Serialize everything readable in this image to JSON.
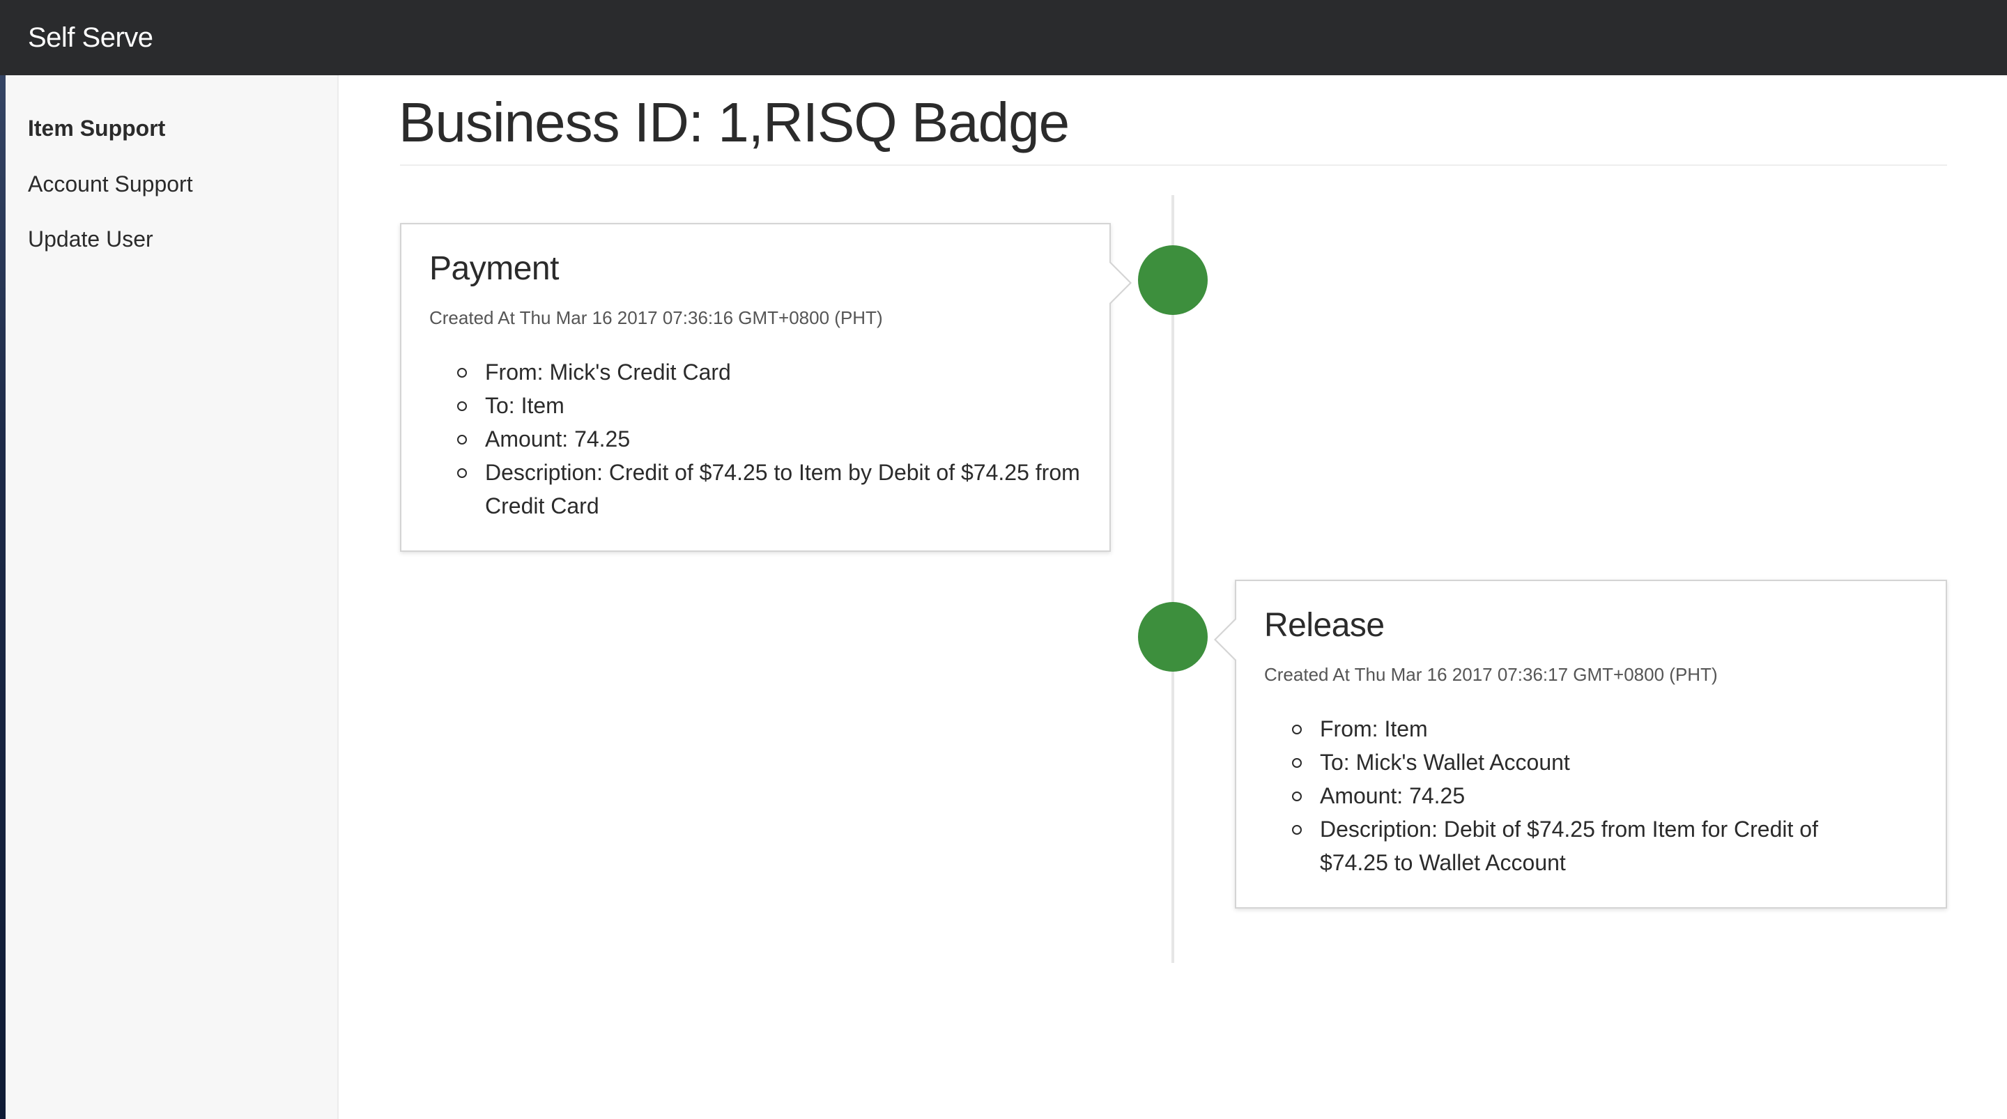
{
  "navbar": {
    "brand": "Self Serve"
  },
  "sidebar": {
    "items": [
      {
        "label": "Item Support",
        "active": true
      },
      {
        "label": "Account Support",
        "active": false
      },
      {
        "label": "Update User",
        "active": false
      }
    ]
  },
  "main": {
    "title": "Business ID: 1,RISQ Badge",
    "timeline": [
      {
        "title": "Payment",
        "created": "Created At Thu Mar 16 2017 07:36:16 GMT+0800 (PHT)",
        "details": [
          "From: Mick's Credit Card",
          "To: Item",
          "Amount: 74.25",
          "Description: Credit of $74.25 to Item by Debit of $74.25 from Credit Card"
        ]
      },
      {
        "title": "Release",
        "created": "Created At Thu Mar 16 2017 07:36:17 GMT+0800 (PHT)",
        "details": [
          "From: Item",
          "To: Mick's Wallet Account",
          "Amount: 74.25",
          "Description: Debit of $74.25 from Item for Credit of $74.25 to Wallet Account"
        ]
      }
    ]
  },
  "colors": {
    "navbar_bg": "#2a2b2d",
    "dot_green": "#3d8f3d",
    "sidebar_bg": "#f7f7f7"
  }
}
